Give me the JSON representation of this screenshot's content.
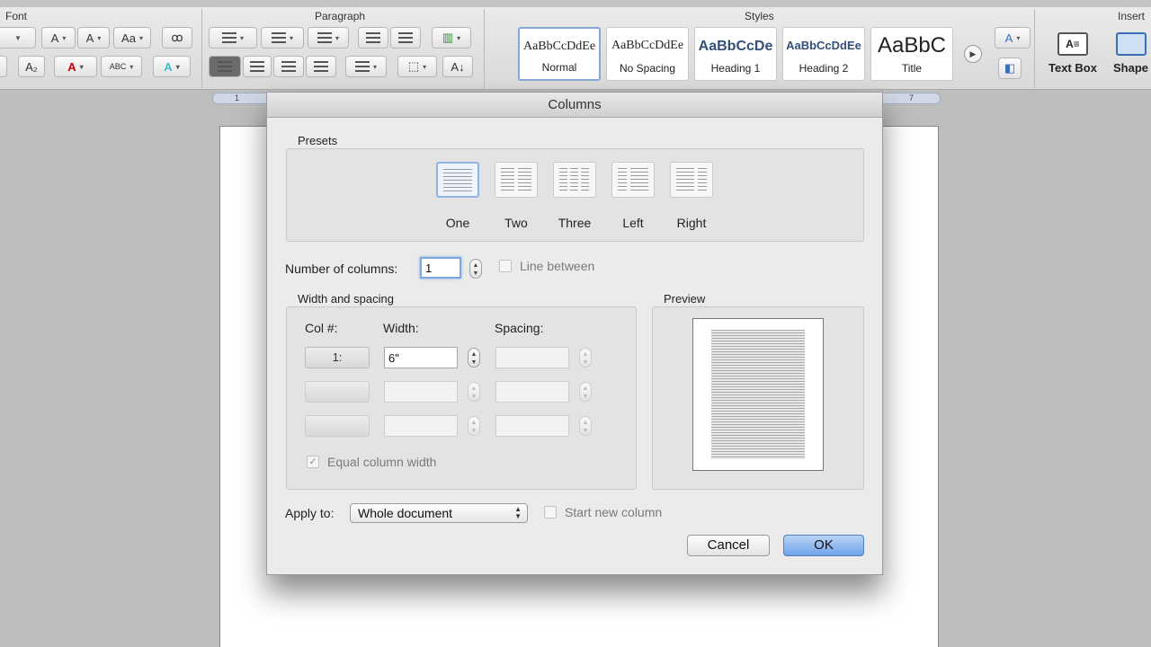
{
  "ribbon": {
    "groups": {
      "font": "Font",
      "paragraph": "Paragraph",
      "styles": "Styles",
      "insert": "Insert"
    },
    "styles": [
      {
        "sample": "AaBbCcDdEe",
        "name": "Normal"
      },
      {
        "sample": "AaBbCcDdEe",
        "name": "No Spacing"
      },
      {
        "sample": "AaBbCcDe",
        "name": "Heading 1"
      },
      {
        "sample": "AaBbCcDdEe",
        "name": "Heading 2"
      },
      {
        "sample": "AaBbC",
        "name": "Title"
      }
    ],
    "insert": {
      "text_box": "Text Box",
      "shape": "Shape"
    }
  },
  "ruler": {
    "left_mark": "1",
    "right_mark": "7"
  },
  "dialog": {
    "title": "Columns",
    "presets_title": "Presets",
    "presets": [
      "One",
      "Two",
      "Three",
      "Left",
      "Right"
    ],
    "selected_preset": "One",
    "num_columns_label": "Number of columns:",
    "num_columns_value": "1",
    "line_between_label": "Line between",
    "width_spacing_title": "Width and spacing",
    "headers": {
      "col": "Col #:",
      "width": "Width:",
      "spacing": "Spacing:"
    },
    "rows": [
      {
        "col": "1:",
        "width": "6\"",
        "spacing": ""
      },
      {
        "col": "",
        "width": "",
        "spacing": ""
      },
      {
        "col": "",
        "width": "",
        "spacing": ""
      }
    ],
    "equal_width_label": "Equal column width",
    "equal_width_checked": true,
    "preview_title": "Preview",
    "apply_to_label": "Apply to:",
    "apply_to_value": "Whole document",
    "start_new_column_label": "Start new column",
    "cancel_label": "Cancel",
    "ok_label": "OK"
  },
  "colors": {
    "accent": "#6fa3e8",
    "dialog_bg": "#ebebeb"
  }
}
